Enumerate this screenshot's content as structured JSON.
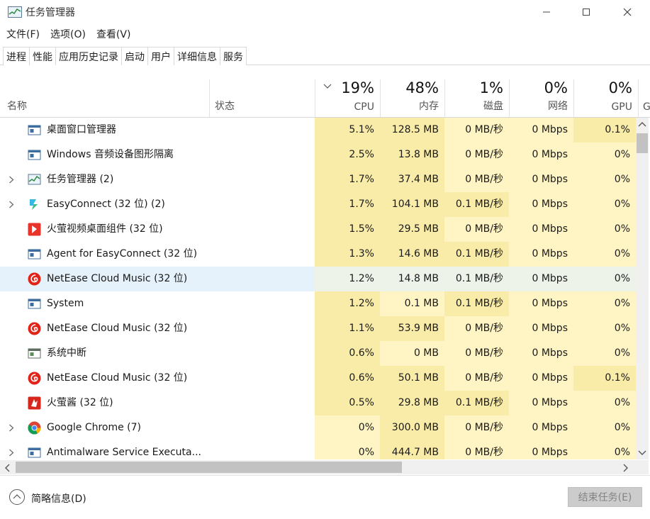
{
  "window": {
    "title": "任务管理器"
  },
  "menu": [
    "文件(F)",
    "选项(O)",
    "查看(V)"
  ],
  "tabs": [
    "进程",
    "性能",
    "应用历史记录",
    "启动",
    "用户",
    "详细信息",
    "服务"
  ],
  "active_tab": 0,
  "header": {
    "name": "名称",
    "status": "状态",
    "columns": [
      {
        "pct": "19%",
        "label": "CPU"
      },
      {
        "pct": "48%",
        "label": "内存"
      },
      {
        "pct": "1%",
        "label": "磁盘"
      },
      {
        "pct": "0%",
        "label": "网络"
      },
      {
        "pct": "0%",
        "label": "GPU"
      }
    ],
    "cut_label": "G"
  },
  "colors": {
    "heat_low": "#fff4c4",
    "heat_mid": "#f9eca8",
    "highlight_row": "#e5f1fb"
  },
  "processes": [
    {
      "name": "桌面窗口管理器",
      "icon": "window-app-icon",
      "expand": false,
      "cpu": "5.1%",
      "mem": "128.5 MB",
      "disk": "0 MB/秒",
      "net": "0 Mbps",
      "gpu": "0.1%",
      "gpu_heat": true,
      "highlight": false
    },
    {
      "name": "Windows 音频设备图形隔离",
      "icon": "window-app-icon",
      "expand": false,
      "cpu": "2.5%",
      "mem": "13.8 MB",
      "disk": "0 MB/秒",
      "net": "0 Mbps",
      "gpu": "0%",
      "gpu_heat": false,
      "highlight": false
    },
    {
      "name": "任务管理器 (2)",
      "icon": "task-manager-icon",
      "expand": true,
      "cpu": "1.7%",
      "mem": "37.4 MB",
      "disk": "0 MB/秒",
      "net": "0 Mbps",
      "gpu": "0%",
      "gpu_heat": false,
      "highlight": false
    },
    {
      "name": "EasyConnect (32 位) (2)",
      "icon": "easyconnect-icon",
      "expand": true,
      "cpu": "1.7%",
      "mem": "104.1 MB",
      "disk": "0.1 MB/秒",
      "net": "0 Mbps",
      "gpu": "0%",
      "gpu_heat": false,
      "highlight": false
    },
    {
      "name": "火萤视频桌面组件 (32 位)",
      "icon": "huoying-video-icon",
      "expand": false,
      "cpu": "1.5%",
      "mem": "29.5 MB",
      "disk": "0 MB/秒",
      "net": "0 Mbps",
      "gpu": "0%",
      "gpu_heat": false,
      "highlight": false
    },
    {
      "name": "Agent for EasyConnect (32 位)",
      "icon": "window-app-icon",
      "expand": false,
      "cpu": "1.3%",
      "mem": "14.6 MB",
      "disk": "0.1 MB/秒",
      "net": "0 Mbps",
      "gpu": "0%",
      "gpu_heat": false,
      "highlight": false
    },
    {
      "name": "NetEase Cloud Music (32 位)",
      "icon": "netease-music-icon",
      "expand": false,
      "cpu": "1.2%",
      "mem": "14.8 MB",
      "disk": "0.1 MB/秒",
      "net": "0 Mbps",
      "gpu": "0%",
      "gpu_heat": false,
      "highlight": true
    },
    {
      "name": "System",
      "icon": "window-app-icon",
      "expand": false,
      "cpu": "1.2%",
      "mem": "0.1 MB",
      "disk": "0.1 MB/秒",
      "net": "0 Mbps",
      "gpu": "0%",
      "gpu_heat": false,
      "highlight": false
    },
    {
      "name": "NetEase Cloud Music (32 位)",
      "icon": "netease-music-icon",
      "expand": false,
      "cpu": "1.1%",
      "mem": "53.9 MB",
      "disk": "0 MB/秒",
      "net": "0 Mbps",
      "gpu": "0%",
      "gpu_heat": false,
      "highlight": false
    },
    {
      "name": "系统中断",
      "icon": "system-interrupt-icon",
      "expand": false,
      "cpu": "0.6%",
      "mem": "0 MB",
      "disk": "0 MB/秒",
      "net": "0 Mbps",
      "gpu": "0%",
      "gpu_heat": false,
      "highlight": false
    },
    {
      "name": "NetEase Cloud Music (32 位)",
      "icon": "netease-music-icon",
      "expand": false,
      "cpu": "0.6%",
      "mem": "50.1 MB",
      "disk": "0 MB/秒",
      "net": "0 Mbps",
      "gpu": "0.1%",
      "gpu_heat": true,
      "highlight": false
    },
    {
      "name": "火萤酱 (32 位)",
      "icon": "huoying-jiang-icon",
      "expand": false,
      "cpu": "0.5%",
      "mem": "29.8 MB",
      "disk": "0.1 MB/秒",
      "net": "0 Mbps",
      "gpu": "0%",
      "gpu_heat": false,
      "highlight": false
    },
    {
      "name": "Google Chrome (7)",
      "icon": "chrome-icon",
      "expand": true,
      "cpu": "0%",
      "mem": "300.0 MB",
      "disk": "0 MB/秒",
      "net": "0 Mbps",
      "gpu": "0%",
      "gpu_heat": false,
      "highlight": false
    },
    {
      "name": "Antimalware Service Executa...",
      "icon": "window-app-icon",
      "expand": true,
      "cpu": "0%",
      "mem": "444.7 MB",
      "disk": "0 MB/秒",
      "net": "0 Mbps",
      "gpu": "0%",
      "gpu_heat": false,
      "highlight": false
    }
  ],
  "footer": {
    "fewer_details": "简略信息(D)",
    "end_task": "结束任务(E)"
  }
}
